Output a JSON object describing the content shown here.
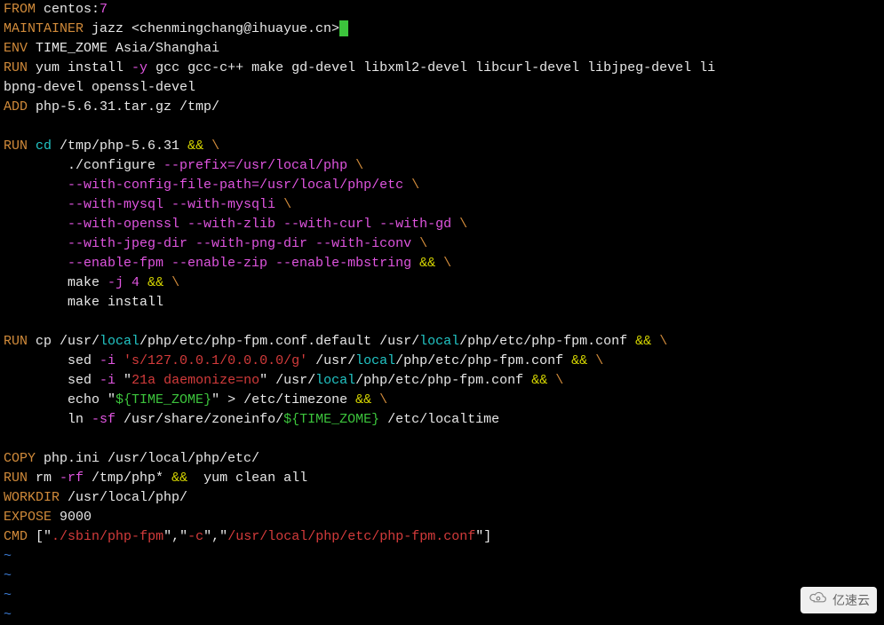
{
  "dockerfile": {
    "from_kw": "FROM",
    "from_img": " centos:",
    "from_tag": "7",
    "maint_kw": "MAINTAINER",
    "maint_val": " jazz <chenmingchang@ihuayue.cn>",
    "env_kw": "ENV",
    "env_key": " TIME_ZOME",
    "env_val": " Asia/Shanghai",
    "run1_kw": "RUN",
    "run1_cmd": " yum install ",
    "run1_flag": "-y",
    "run1_rest": " gcc gcc-c++ make gd-devel libxml2-devel libcurl-devel libjpeg-devel li",
    "run1_cont": "bpng-devel openssl-devel",
    "add_kw": "ADD",
    "add_val": " php-5.6.31.tar.gz /tmp/",
    "run2_kw": "RUN",
    "run2_cd": " cd",
    "run2_path": " /tmp/php-5.6.31 ",
    "andand": "&& ",
    "bslash": "\\",
    "conf1": "        ./configure ",
    "conf1_opts": "--prefix=/usr/local/php ",
    "conf2": "        ",
    "conf2_opts": "--with-config-file-path=/usr/local/php/etc ",
    "conf3_opts": "--with-mysql --with-mysqli ",
    "conf4_opts": "--with-openssl --with-zlib --with-curl --with-gd ",
    "conf5_opts": "--with-jpeg-dir --with-png-dir --with-iconv ",
    "conf6_opts": "--enable-fpm --enable-zip --enable-mbstring ",
    "make1": "        make ",
    "make1_flag": "-j ",
    "make1_num": "4",
    "make2": "        make install",
    "run3_kw": "RUN",
    "run3_cp": " cp /usr/",
    "local": "local",
    "run3_cp2": "/php/etc/php-fpm.conf.default /usr/",
    "run3_cp3": "/php/etc/php-fpm.conf ",
    "sed1_pre": "        sed ",
    "sed_flag": "-i ",
    "sed1_pat": "'s/127.0.0.1/0.0.0.0/g'",
    "sed1_post": " /usr/",
    "sed1_post2": "/php/etc/php-fpm.conf ",
    "sed2_pat_open": "\"",
    "sed2_pat": "21a daemonize=no",
    "sed2_pat_close": "\"",
    "sed2_post": " /usr/",
    "sed2_post2": "/php/etc/php-fpm.conf ",
    "echo_pre": "        echo ",
    "echo_q": "\"",
    "echo_var": "${TIME_ZOME}",
    "echo_post": " > /etc/timezone ",
    "ln_pre": "        ln ",
    "ln_flag": "-sf",
    "ln_post": " /usr/share/zoneinfo/",
    "ln_var": "${TIME_ZOME}",
    "ln_post2": " /etc/localtime",
    "copy_kw": "COPY",
    "copy_val": " php.ini /usr/local/php/etc/",
    "run4_kw": "RUN",
    "run4_cmd": " rm ",
    "run4_flag": "-rf",
    "run4_post": " /tmp/php* ",
    "run4_post2": " yum clean all",
    "workdir_kw": "WORKDIR",
    "workdir_val": " /usr/local/php/",
    "expose_kw": "EXPOSE",
    "expose_val": " 9000",
    "cmd_kw": "CMD",
    "cmd_open": " [",
    "cmd_q": "\"",
    "cmd_a1": "./sbin/php-fpm",
    "cmd_sep": ",",
    "cmd_a2": "-c",
    "cmd_a3": "/usr/local/php/etc/php-fpm.conf",
    "cmd_close": "]",
    "tilde": "~"
  },
  "watermark": {
    "text": "亿速云"
  }
}
